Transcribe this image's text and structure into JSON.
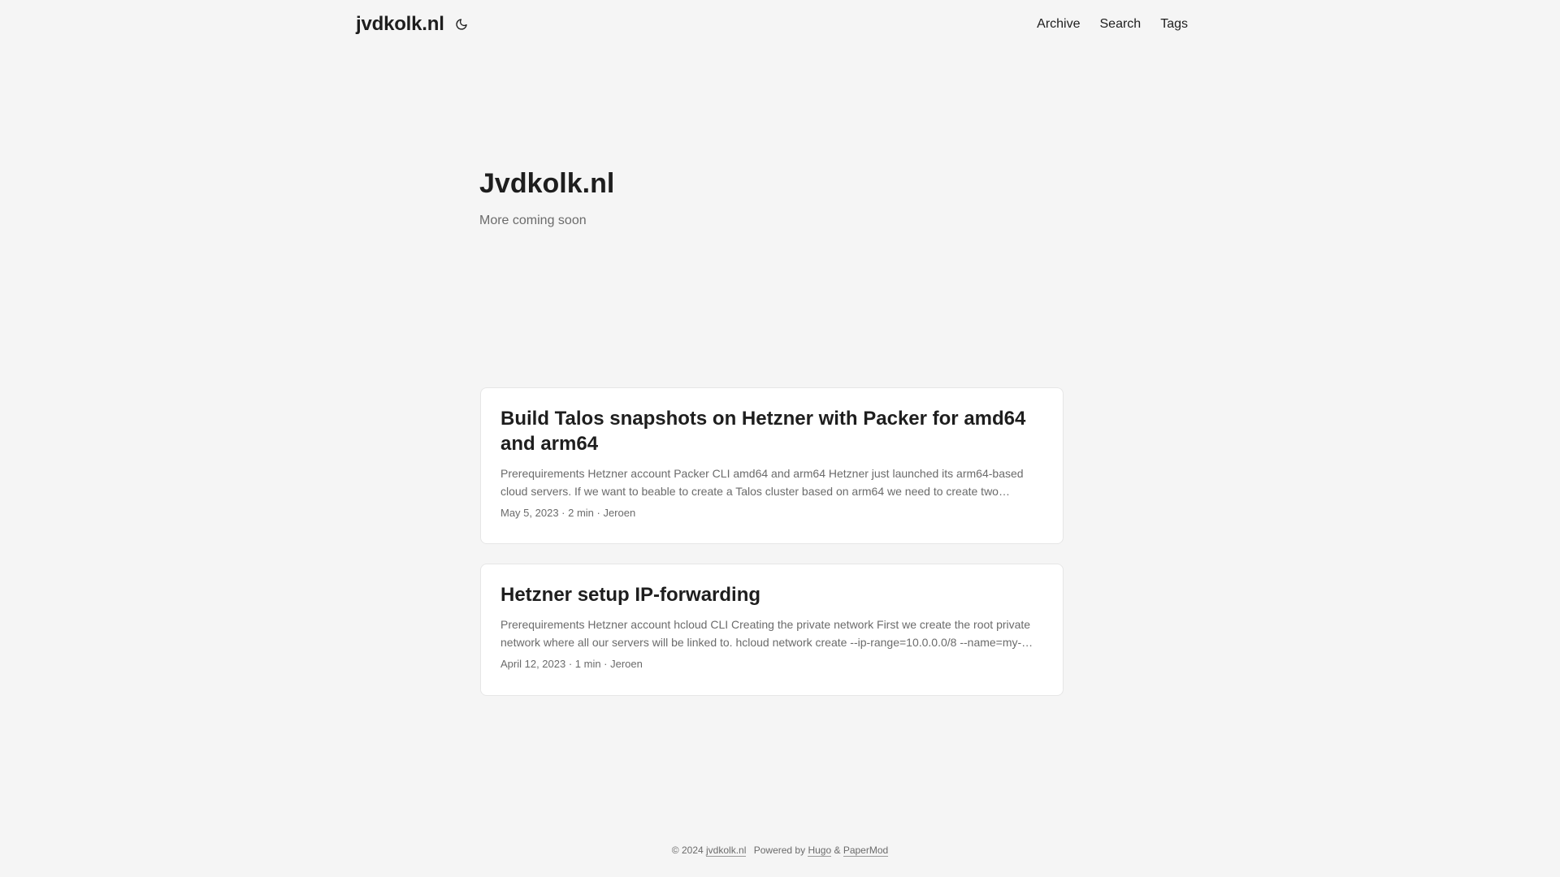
{
  "header": {
    "logo": "jvdkolk.nl",
    "theme_icon": "moon-icon",
    "nav": [
      {
        "label": "Archive"
      },
      {
        "label": "Search"
      },
      {
        "label": "Tags"
      }
    ]
  },
  "hero": {
    "title": "Jvdkolk.nl",
    "subtitle": "More coming soon"
  },
  "posts": [
    {
      "title": "Build Talos snapshots on Hetzner with Packer for amd64 and arm64",
      "excerpt": "Prerequirements Hetzner account Packer CLI amd64 and arm64 Hetzner just launched its arm64-based cloud servers. If we want to beable to create a Talos cluster based on arm64 we need to create two…",
      "meta": "May 5, 2023 · 2 min · Jeroen"
    },
    {
      "title": "Hetzner setup IP-forwarding",
      "excerpt": "Prerequirements Hetzner account hcloud CLI Creating the private network First we create the root private network where all our servers will be linked to. hcloud network create --ip-range=10.0.0.0/8 --name=my-…",
      "meta": "April 12, 2023 · 1 min · Jeroen"
    }
  ],
  "footer": {
    "copyright": "© 2024",
    "site_link": "jvdkolk.nl",
    "powered_by": "Powered by",
    "hugo_link": "Hugo",
    "amp": "&",
    "papermod_link": "PaperMod"
  }
}
